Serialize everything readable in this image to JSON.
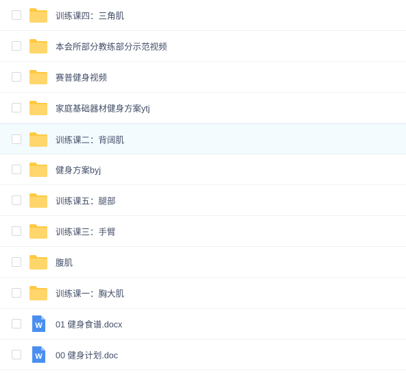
{
  "files": [
    {
      "name": "训练课四：三角肌",
      "type": "folder"
    },
    {
      "name": "本会所部分教练部分示范视频",
      "type": "folder"
    },
    {
      "name": "赛普健身视频",
      "type": "folder"
    },
    {
      "name": "家庭基础器材健身方案ytj",
      "type": "folder"
    },
    {
      "name": "训练课二：背阔肌",
      "type": "folder",
      "hover": true
    },
    {
      "name": "健身方案byj",
      "type": "folder"
    },
    {
      "name": "训练课五：腿部",
      "type": "folder"
    },
    {
      "name": "训练课三：手臂",
      "type": "folder"
    },
    {
      "name": "腹肌",
      "type": "folder"
    },
    {
      "name": "训练课一：胸大肌",
      "type": "folder"
    },
    {
      "name": "01 健身食谱.docx",
      "type": "word",
      "icon_letter": "W"
    },
    {
      "name": "00 健身计划.doc",
      "type": "word",
      "icon_letter": "W"
    }
  ],
  "colors": {
    "folder": "#ffd66b",
    "folder_tab": "#ffc940",
    "word": "#4a8ff0",
    "text": "#424e67",
    "hover_bg": "#f4fbff"
  }
}
